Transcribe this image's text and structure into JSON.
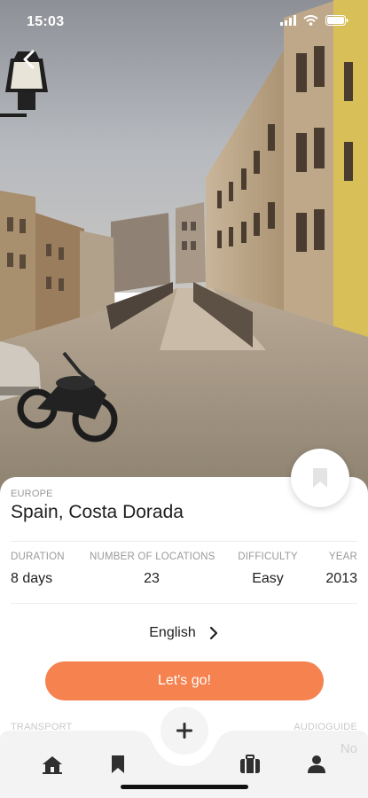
{
  "status_bar": {
    "time": "15:03"
  },
  "hero": {
    "description_icon": "back-chevron-icon"
  },
  "tour": {
    "region": "EUROPE",
    "title": "Spain, Costa Dorada",
    "stats": [
      {
        "label": "DURATION",
        "value": "8 days"
      },
      {
        "label": "NUMBER OF LOCATIONS",
        "value": "23"
      },
      {
        "label": "DIFFICULTY",
        "value": "Easy"
      },
      {
        "label": "YEAR",
        "value": "2013"
      }
    ],
    "language": "English",
    "cta_label": "Let's go!",
    "transport_label": "TRANSPORT",
    "audioguide_label": "AUDIOGUIDE",
    "audioguide_value": "No"
  },
  "tabbar": {
    "items": [
      "home-icon",
      "bookmark-icon",
      "add-icon",
      "suitcase-icon",
      "profile-icon"
    ]
  },
  "colors": {
    "accent": "#f5824f",
    "muted_label": "#9a9a9a",
    "tab_icon": "#2f2f2f"
  }
}
